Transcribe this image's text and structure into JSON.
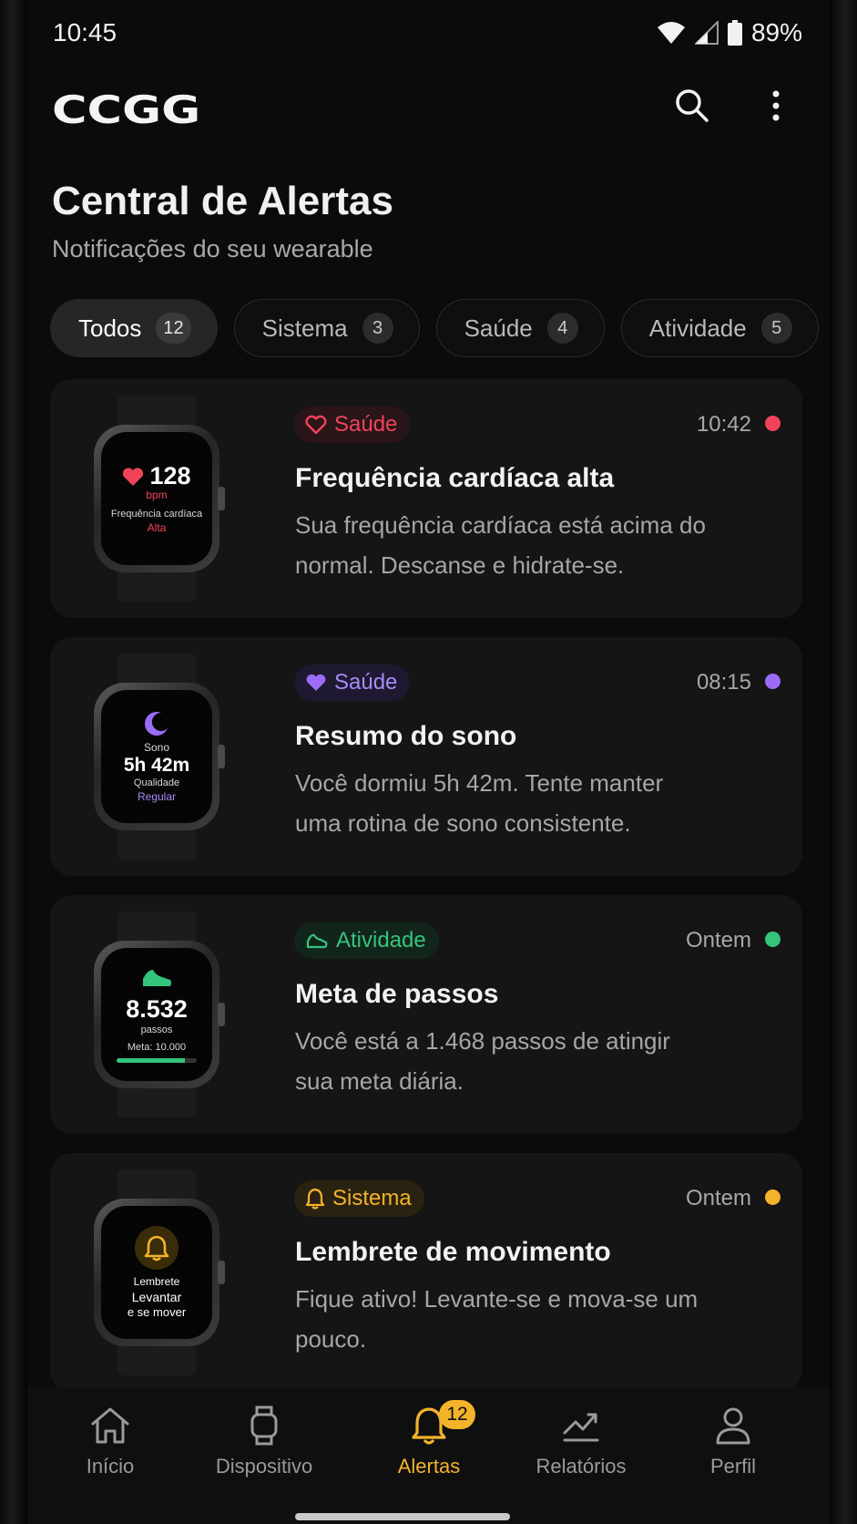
{
  "status_bar": {
    "time": "10:45",
    "battery": "89%"
  },
  "header": {
    "logo": "CCGG"
  },
  "page": {
    "title": "Central de Alertas",
    "subtitle": "Notificações do seu wearable"
  },
  "filters": [
    {
      "label": "Todos",
      "count": "12"
    },
    {
      "label": "Sistema",
      "count": "3"
    },
    {
      "label": "Saúde",
      "count": "4"
    },
    {
      "label": "Atividade",
      "count": "5"
    }
  ],
  "alerts": [
    {
      "category": "Saúde",
      "time": "10:42",
      "title": "Frequência cardíaca alta",
      "body": "Sua frequência cardíaca está acima do normal. Descanse e hidrate-se.",
      "color": "#f0435a",
      "icon": "heart-icon",
      "watch": {
        "value": "128",
        "unit": "bpm",
        "caption": "Frequência cardíaca",
        "status": "Alta"
      }
    },
    {
      "category": "Saúde",
      "time": "08:15",
      "title": "Resumo do sono",
      "body": "Você dormiu 5h 42m. Tente manter uma rotina de sono consistente.",
      "color": "#9b6cf7",
      "icon": "heart-icon",
      "watch": {
        "label": "Sono",
        "value": "5h 42m",
        "caption": "Qualidade",
        "status": "Regular"
      }
    },
    {
      "category": "Atividade",
      "time": "Ontem",
      "title": "Meta de passos",
      "body": "Você está a 1.468 passos de atingir sua meta diária.",
      "color": "#34c47c",
      "icon": "shoe-icon",
      "watch": {
        "value": "8.532",
        "unit": "passos",
        "caption": "Meta: 10.000",
        "progress": 0.853
      }
    },
    {
      "category": "Sistema",
      "time": "Ontem",
      "title": "Lembrete de movimento",
      "body": "Fique ativo! Levante-se e mova-se um pouco.",
      "color": "#f3b32b",
      "icon": "bell-icon",
      "watch": {
        "line1": "Lembrete",
        "line2": "Levantar",
        "line3": "e se mover"
      }
    }
  ],
  "nav": [
    {
      "label": "Início",
      "icon": "home-icon"
    },
    {
      "label": "Dispositivo",
      "icon": "watch-icon"
    },
    {
      "label": "Alertas",
      "icon": "bell-icon",
      "badge": "12"
    },
    {
      "label": "Relatórios",
      "icon": "chart-icon"
    },
    {
      "label": "Perfil",
      "icon": "profile-icon"
    }
  ]
}
